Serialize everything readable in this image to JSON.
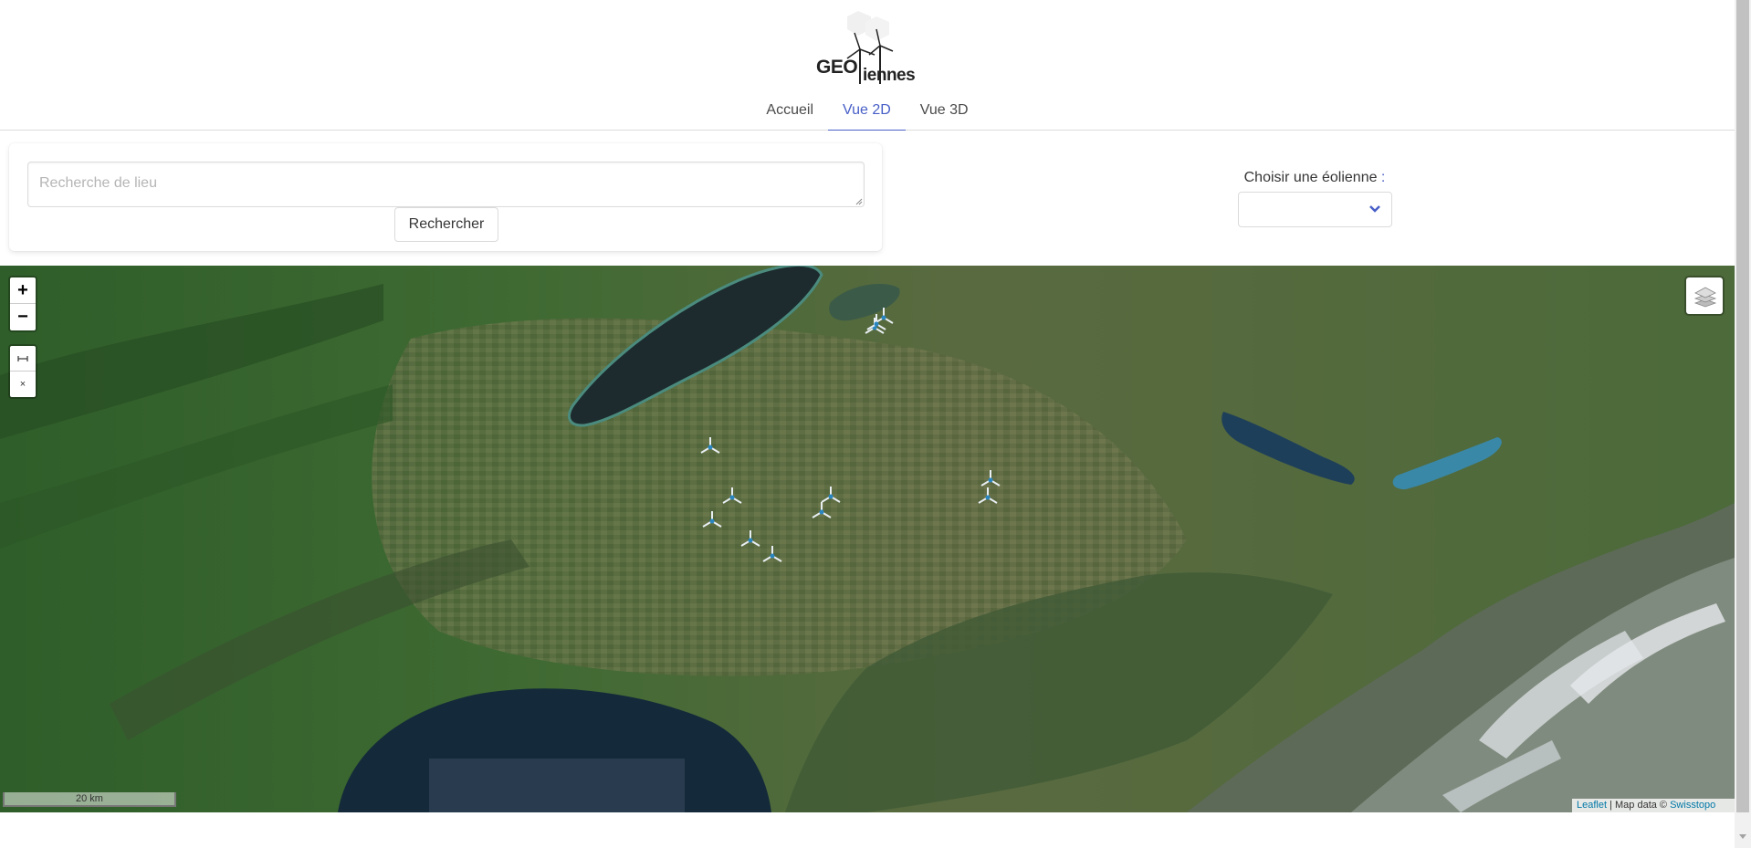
{
  "header": {
    "logo_text_left": "GEO",
    "logo_text_right": "iennes",
    "tabs": [
      {
        "label": "Accueil",
        "active": false
      },
      {
        "label": "Vue 2D",
        "active": true
      },
      {
        "label": "Vue 3D",
        "active": false
      }
    ]
  },
  "search": {
    "placeholder": "Recherche de lieu",
    "button_label": "Rechercher"
  },
  "turbine_select": {
    "label": "Choisir une éolienne",
    "label_colon": " :",
    "value": ""
  },
  "map": {
    "zoom_in": "+",
    "zoom_out": "−",
    "measure_icon": "ruler-icon",
    "clear_icon": "×",
    "layers_icon": "layers-icon",
    "scale_label": "20 km",
    "attribution_leaflet": "Leaflet",
    "attribution_sep": " | Map data © ",
    "attribution_source": "Swisstopo",
    "turbine_markers": 12
  },
  "colors": {
    "accent": "#485fc7",
    "link": "#0078a8"
  }
}
